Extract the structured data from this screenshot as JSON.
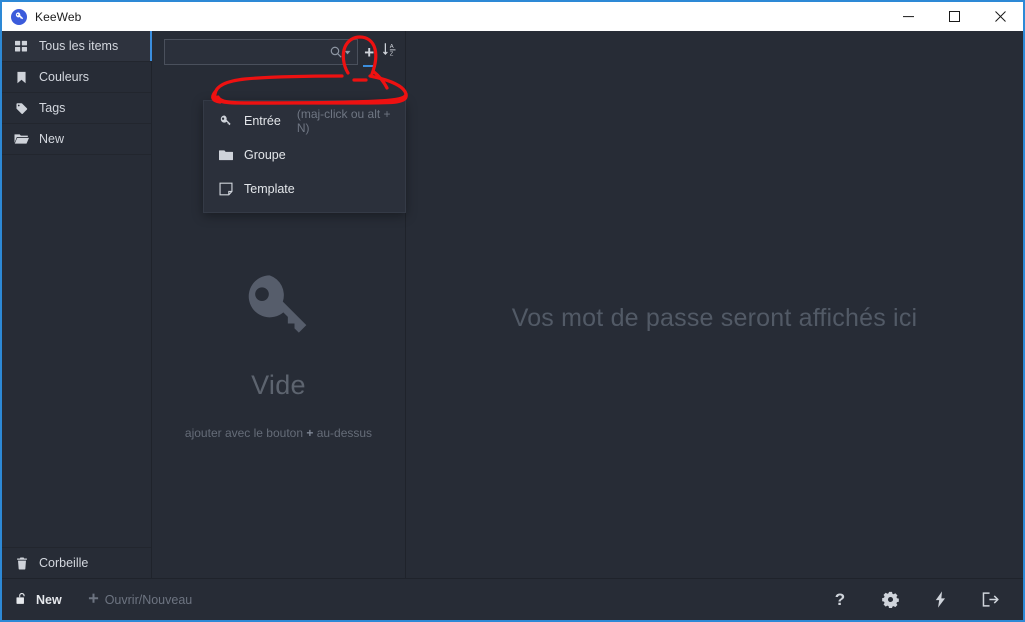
{
  "window": {
    "title": "KeeWeb",
    "logo_icon": "key-circle-icon",
    "controls": {
      "minimize": "minimize-icon",
      "maximize": "maximize-icon",
      "close": "close-icon"
    }
  },
  "sidebar": {
    "items": [
      {
        "label": "Tous les items",
        "icon": "grid-icon",
        "active": true
      },
      {
        "label": "Couleurs",
        "icon": "bookmark-icon",
        "active": false
      },
      {
        "label": "Tags",
        "icon": "tag-icon",
        "active": false
      },
      {
        "label": "New",
        "icon": "folder-open-icon",
        "active": false
      }
    ],
    "trash": {
      "label": "Corbeille",
      "icon": "trash-icon"
    }
  },
  "list_panel": {
    "search": {
      "value": "",
      "placeholder": "",
      "icon": "search-icon",
      "dropdown_icon": "caret-down-icon"
    },
    "add_button": {
      "label": "+",
      "icon": "plus-icon",
      "selected": true
    },
    "sort_button": {
      "icon": "sort-alpha-desc-icon"
    },
    "empty_state": {
      "icon": "key-icon",
      "title": "Vide",
      "subtitle_before": "ajouter avec le bouton ",
      "subtitle_plus": "+",
      "subtitle_after": " au-dessus"
    }
  },
  "dropdown": {
    "items": [
      {
        "label": "Entrée",
        "hint": "(maj-click ou alt + N)",
        "icon": "key-icon"
      },
      {
        "label": "Groupe",
        "hint": "",
        "icon": "folder-icon"
      },
      {
        "label": "Template",
        "hint": "",
        "icon": "template-icon"
      }
    ]
  },
  "details_panel": {
    "placeholder_text": "Vos mot de passe seront affichés ici"
  },
  "footer": {
    "file": {
      "label": "New",
      "icon": "unlock-icon"
    },
    "open": {
      "label": "Ouvrir/Nouveau",
      "icon": "plus-icon"
    },
    "buttons": [
      {
        "name": "help",
        "icon": "question-mark-icon",
        "glyph": "?"
      },
      {
        "name": "settings",
        "icon": "gear-icon",
        "glyph": ""
      },
      {
        "name": "generator",
        "icon": "bolt-icon",
        "glyph": ""
      },
      {
        "name": "lock",
        "icon": "exit-icon",
        "glyph": ""
      }
    ]
  },
  "annotation": {
    "color": "#ee1111",
    "shapes": [
      "circle-around-plus-button",
      "ellipse-around-entree-item"
    ]
  },
  "colors": {
    "accent_blue": "#3b8ede",
    "window_border": "#2d89d6",
    "panel_bg": "#272c36",
    "menu_bg": "#2b303b",
    "annotation_red": "#ee1111"
  }
}
